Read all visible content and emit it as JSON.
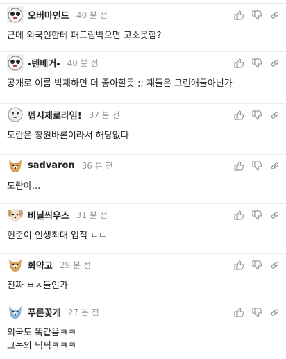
{
  "comments": [
    {
      "nickname": "오버마인드",
      "time": "40 분 전",
      "avatar": "ghost-face-avatar",
      "lines": [
        "근데 외국인한테 패드립박으면 고소못함?"
      ]
    },
    {
      "nickname": "-텐베거-",
      "time": "40 분 전",
      "avatar": "ghost-face-avatar",
      "lines": [
        "공개로 이름 박제하면 더 좋아할듯 ;; 쟤들은 그런애들아닌가"
      ]
    },
    {
      "nickname": "펩시제로라임!",
      "time": "37 분 전",
      "avatar": "round-face-avatar",
      "lines": [
        "도란은 창원바론이라서 해당없다"
      ]
    },
    {
      "nickname": "sadvaron",
      "time": "36 분 전",
      "avatar": "dog-avatar",
      "lines": [
        "도란아..."
      ]
    },
    {
      "nickname": "비닐씌우스",
      "time": "31 분 전",
      "avatar": "puppy-avatar",
      "lines": [
        "현준이 인생최대 업적 ㄷㄷ"
      ]
    },
    {
      "nickname": "화약고",
      "time": "29 분 전",
      "avatar": "dog-avatar",
      "lines": [
        "진짜 ㅂㅅ들인가"
      ]
    },
    {
      "nickname": "푸른꽃게",
      "time": "27 분 전",
      "avatar": "blue-dog-avatar",
      "lines": [
        "외국도 똑같음ㅋㅋ",
        "그놈의 딕픽ㅋㅋㅋ"
      ]
    }
  ],
  "actions": [
    "thumbs-up-icon",
    "thumbs-down-icon",
    "link-icon"
  ],
  "colors": {
    "nickname": "#222222",
    "time": "#999999",
    "icon": "#999999",
    "divider": "#ececec"
  }
}
